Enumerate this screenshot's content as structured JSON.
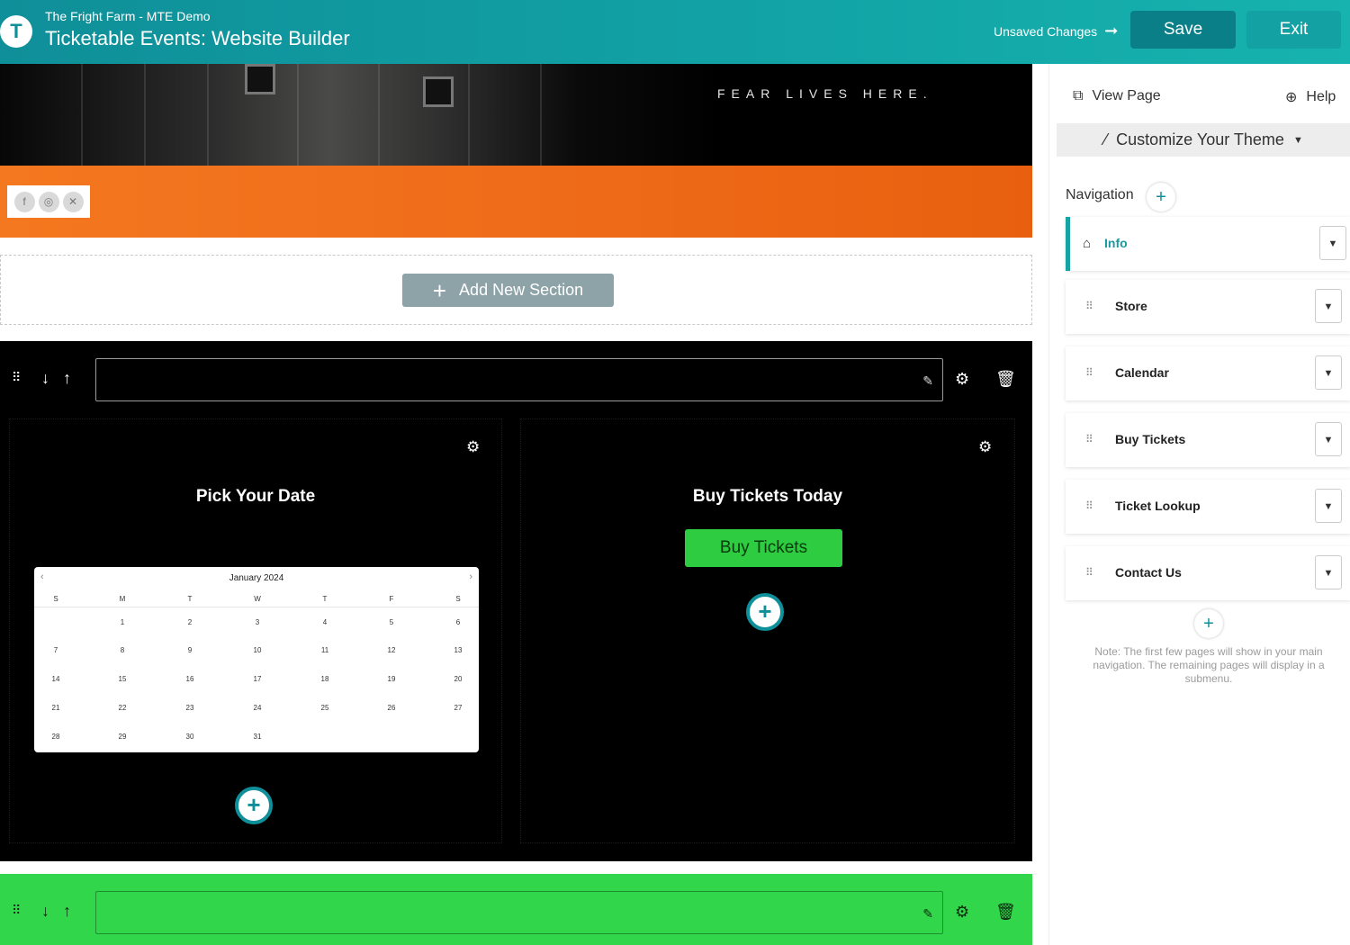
{
  "header": {
    "org_name": "The Fright Farm - MTE Demo",
    "app_title": "Ticketable Events: Website Builder",
    "unsaved_label": "Unsaved Changes",
    "save_label": "Save",
    "exit_label": "Exit",
    "logo_letter": "T"
  },
  "canvas": {
    "hero_tagline": "FEAR LIVES HERE.",
    "social_icons": [
      "f",
      "◎",
      "✕"
    ],
    "add_section_label": "Add New Section",
    "col_left_title": "Pick Your Date",
    "col_right_title": "Buy Tickets Today",
    "buy_button_label": "Buy Tickets",
    "calendar": {
      "month_label": "January 2024",
      "weekdays": [
        "S",
        "M",
        "T",
        "W",
        "T",
        "F",
        "S"
      ],
      "weeks": [
        [
          "",
          "1",
          "2",
          "3",
          "4",
          "5",
          "6"
        ],
        [
          "7",
          "8",
          "9",
          "10",
          "11",
          "12",
          "13"
        ],
        [
          "14",
          "15",
          "16",
          "17",
          "18",
          "19",
          "20"
        ],
        [
          "21",
          "22",
          "23",
          "24",
          "25",
          "26",
          "27"
        ],
        [
          "28",
          "29",
          "30",
          "31",
          "",
          "",
          ""
        ]
      ]
    }
  },
  "sidebar": {
    "view_page_label": "View Page",
    "help_label": "Help",
    "customize_label": "Customize Your Theme",
    "navigation_label": "Navigation",
    "nav_items": [
      {
        "label": "Info",
        "active": true
      },
      {
        "label": "Store"
      },
      {
        "label": "Calendar"
      },
      {
        "label": "Buy Tickets"
      },
      {
        "label": "Ticket Lookup"
      },
      {
        "label": "Contact Us"
      }
    ],
    "note": "Note: The first few pages will show in your main navigation. The remaining pages will display in a submenu."
  },
  "colors": {
    "brand_teal": "#0f8f99",
    "orange_band": "#ef6c1a",
    "green_section": "#32d64a",
    "buy_button": "#2ecc40"
  }
}
